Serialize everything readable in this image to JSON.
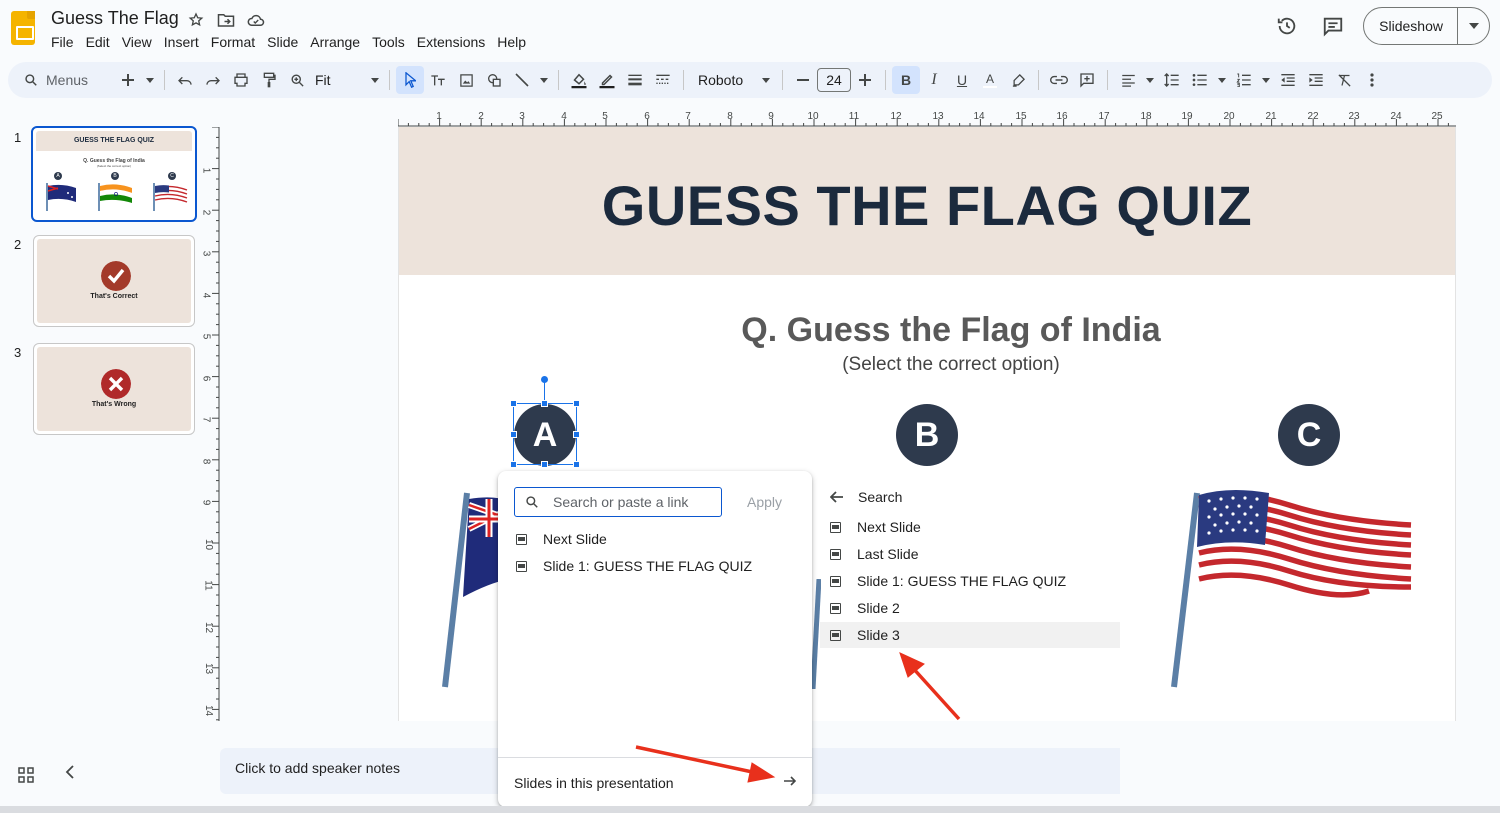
{
  "app": {
    "title": "Guess The Flag",
    "menu": [
      "File",
      "Edit",
      "View",
      "Insert",
      "Format",
      "Slide",
      "Arrange",
      "Tools",
      "Extensions",
      "Help"
    ],
    "slideshow_label": "Slideshow"
  },
  "toolbar": {
    "search_placeholder": "Menus",
    "zoom": "Fit",
    "font": "Roboto",
    "font_size": "24",
    "bold_label": "B",
    "italic_label": "I",
    "underline_label": "U",
    "text_color_label": "A"
  },
  "filmstrip": {
    "slides": [
      {
        "number": "1",
        "head": "GUESS THE FLAG QUIZ",
        "q": "Q. Guess the Flag of India",
        "sub": "(Select the correct option)",
        "opts": [
          "A",
          "B",
          "C"
        ]
      },
      {
        "number": "2",
        "message": "That's Correct"
      },
      {
        "number": "3",
        "message": "That's Wrong"
      }
    ]
  },
  "ruler": {
    "h": [
      "1",
      "2",
      "3",
      "4",
      "5",
      "6",
      "7",
      "8",
      "9",
      "10",
      "11",
      "12",
      "13",
      "14",
      "15",
      "16",
      "17",
      "18",
      "19",
      "20",
      "21",
      "22",
      "23",
      "24",
      "25"
    ],
    "v": [
      "1",
      "2",
      "3",
      "4",
      "5",
      "6",
      "7",
      "8",
      "9",
      "10",
      "11",
      "12",
      "13",
      "14"
    ]
  },
  "slide": {
    "title": "GUESS THE FLAG QUIZ",
    "question": "Q. Guess the Flag of India",
    "subtitle": "(Select the correct option)",
    "options": [
      "A",
      "B",
      "C"
    ]
  },
  "link_popup": {
    "search_placeholder": "Search or paste a link",
    "apply": "Apply",
    "items": [
      "Next Slide",
      "Slide 1: GUESS THE FLAG QUIZ"
    ],
    "footer": "Slides in this presentation"
  },
  "slides_panel": {
    "back_label": "Search",
    "items": [
      "Next Slide",
      "Last Slide",
      "Slide 1: GUESS THE FLAG QUIZ",
      "Slide 2",
      "Slide 3"
    ],
    "highlighted_index": 4
  },
  "notes": {
    "placeholder": "Click to add speaker notes"
  },
  "colors": {
    "accent": "#0b57d0",
    "slide_header_bg": "#ede3db",
    "title_text": "#1b2a3d",
    "option_circle": "#2e3a4d",
    "correct_badge": "#a33a2a",
    "wrong_badge": "#b02a2a",
    "annotation_arrow": "#e8301c"
  }
}
